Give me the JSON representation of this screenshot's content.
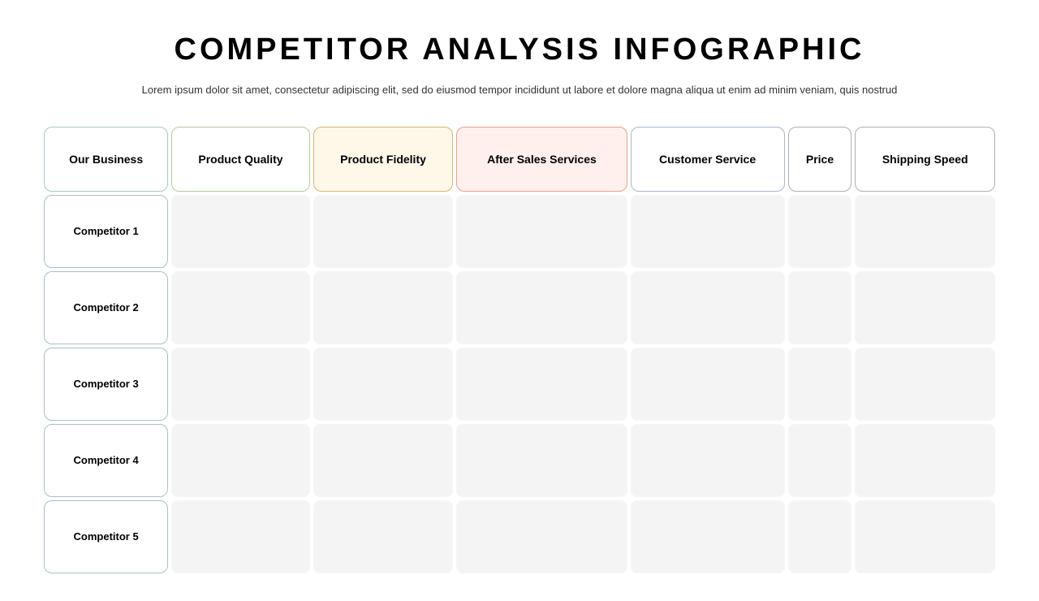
{
  "page": {
    "title": "COMPETITOR ANALYSIS INFOGRAPHIC",
    "subtitle": "Lorem ipsum dolor sit amet, consectetur adipiscing elit, sed do eiusmod tempor incididunt ut labore et dolore magna aliqua ut enim ad minim veniam, quis nostrud"
  },
  "table": {
    "headers": [
      {
        "id": "our-business",
        "label": "Our Business",
        "style": "our-business"
      },
      {
        "id": "product-quality",
        "label": "Product Quality",
        "style": "product-quality"
      },
      {
        "id": "product-fidelity",
        "label": "Product Fidelity",
        "style": "product-fidelity"
      },
      {
        "id": "after-sales",
        "label": "After Sales Services",
        "style": "after-sales"
      },
      {
        "id": "customer-service",
        "label": "Customer Service",
        "style": "customer-service"
      },
      {
        "id": "price",
        "label": "Price",
        "style": "price"
      },
      {
        "id": "shipping-speed",
        "label": "Shipping Speed",
        "style": "shipping"
      }
    ],
    "rows": [
      {
        "label": "Competitor 1"
      },
      {
        "label": "Competitor 2"
      },
      {
        "label": "Competitor 3"
      },
      {
        "label": "Competitor 4"
      },
      {
        "label": "Competitor 5"
      }
    ]
  }
}
